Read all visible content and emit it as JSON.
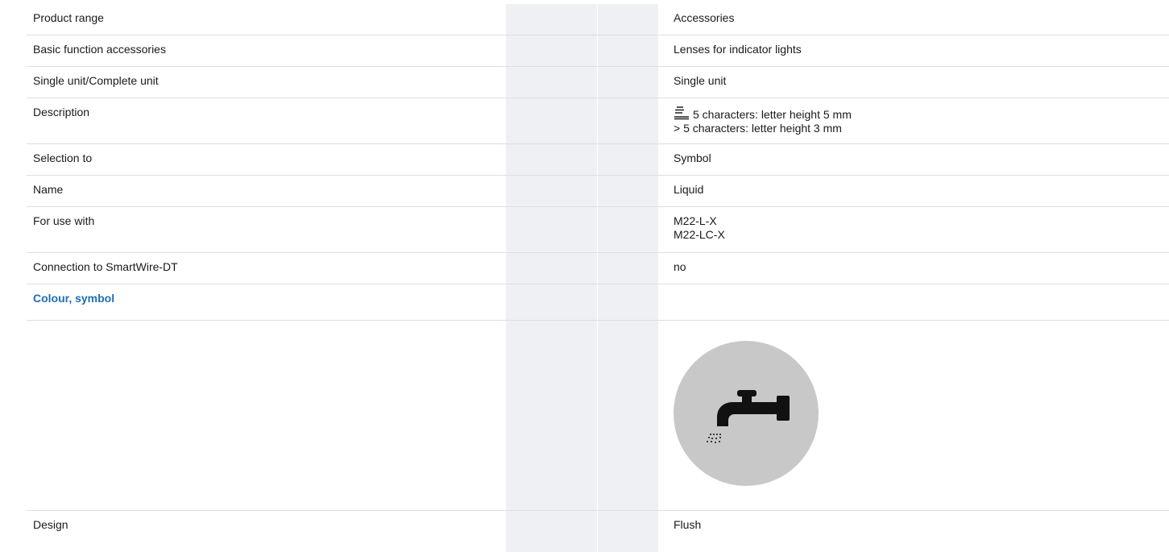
{
  "rows": [
    {
      "label": "Product range",
      "value": "Accessories"
    },
    {
      "label": "Basic function accessories",
      "value": "Lenses for indicator lights"
    },
    {
      "label": "Single unit/Complete unit",
      "value": "Single unit"
    },
    {
      "label": "Description",
      "value_line1": "5 characters: letter height 5 mm",
      "value_line2": "> 5 characters: letter height 3 mm"
    },
    {
      "label": "Selection to",
      "value": "Symbol"
    },
    {
      "label": "Name",
      "value": "Liquid"
    },
    {
      "label": "For use with",
      "value_line1": "M22-L-X",
      "value_line2": "M22-LC-X"
    },
    {
      "label": "Connection to SmartWire-DT",
      "value": "no"
    },
    {
      "label": "Colour, symbol"
    },
    {
      "symbol": "liquid-tap-symbol",
      "lens_color": "#c8c8c8",
      "symbol_color": "#111111"
    },
    {
      "label": "Design",
      "value": "Flush"
    }
  ],
  "icons": {
    "description_icon": "label-lines-icon"
  },
  "colors": {
    "section_title": "#1f6eb5",
    "shaded_column": "#eef0f3",
    "row_border": "#dcdfe4"
  }
}
